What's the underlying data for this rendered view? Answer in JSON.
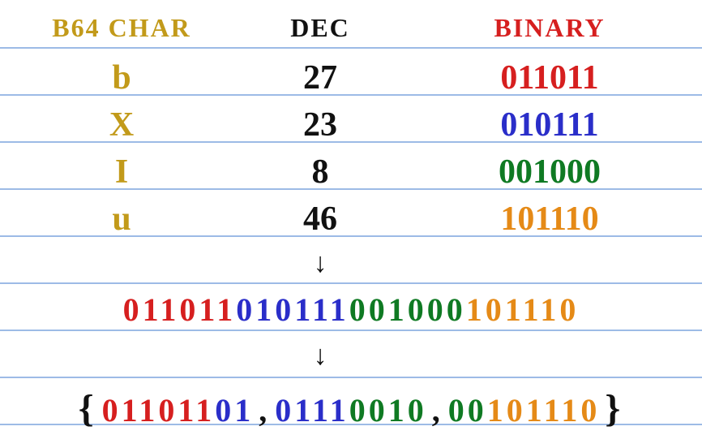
{
  "colors": {
    "ochre": "#c29a1a",
    "black": "#111111",
    "red": "#d61f1f",
    "blue": "#2a2ec9",
    "green": "#0f7a23",
    "orange": "#e58a17",
    "rule": "#9dbbe6"
  },
  "headers": {
    "char": "B64 CHAR",
    "dec": "DEC",
    "bin": "BINARY"
  },
  "rows": [
    {
      "char": "b",
      "dec": "27",
      "bin": "011011",
      "bin_color": "red"
    },
    {
      "char": "X",
      "dec": "23",
      "bin": "010111",
      "bin_color": "blue"
    },
    {
      "char": "I",
      "dec": "8",
      "bin": "001000",
      "bin_color": "green"
    },
    {
      "char": "u",
      "dec": "46",
      "bin": "101110",
      "bin_color": "orange"
    }
  ],
  "arrow": "↓",
  "concatenated": [
    {
      "text": "011011",
      "color": "red"
    },
    {
      "text": "010111",
      "color": "blue"
    },
    {
      "text": "001000",
      "color": "green"
    },
    {
      "text": "101110",
      "color": "orange"
    }
  ],
  "bytes_open": "{",
  "bytes_close": "}",
  "bytes_sep": ",",
  "bytes": [
    [
      {
        "text": "011011",
        "color": "red"
      },
      {
        "text": "01",
        "color": "blue"
      }
    ],
    [
      {
        "text": "0111",
        "color": "blue"
      },
      {
        "text": "0010",
        "color": "green"
      }
    ],
    [
      {
        "text": "00",
        "color": "green"
      },
      {
        "text": "101110",
        "color": "orange"
      }
    ]
  ],
  "chart_data": {
    "type": "table",
    "title": "Base64 decoding of bXIu",
    "columns": [
      "B64 CHAR",
      "DEC",
      "BINARY"
    ],
    "rows": [
      [
        "b",
        27,
        "011011"
      ],
      [
        "X",
        23,
        "010111"
      ],
      [
        "I",
        8,
        "001000"
      ],
      [
        "u",
        46,
        "101110"
      ]
    ],
    "concatenated_bits": "011011010111001000101110",
    "bytes": [
      "01101101",
      "01110010",
      "00101110"
    ]
  }
}
